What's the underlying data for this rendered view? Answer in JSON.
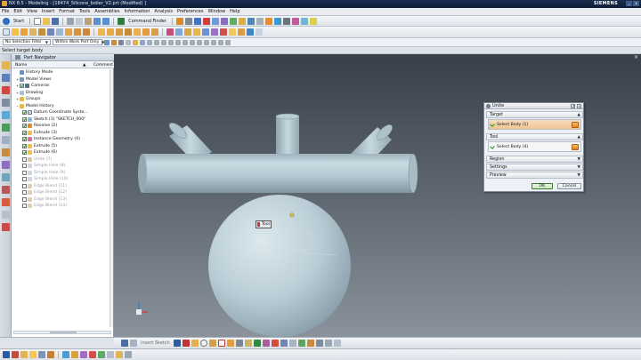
{
  "window": {
    "title": "NX 8.5 - Modeling - [18474_Silicone_boiler_V2.prt (Modified) ]",
    "brand": "SIEMENS"
  },
  "menu": [
    "File",
    "Edit",
    "View",
    "Insert",
    "Format",
    "Tools",
    "Assemblies",
    "Information",
    "Analysis",
    "Preferences",
    "Window",
    "Help"
  ],
  "toolbar": {
    "start_label": "Start",
    "command_finder_label": "Command Finder",
    "selection_filter": "No Selection Filter",
    "selection_scope": "Within Work Part Only"
  },
  "cue_line": "Select target body",
  "part_navigator": {
    "title": "Part Navigator",
    "col_name": "Name",
    "col_comment": "Comment",
    "items": [
      {
        "label": "History Mode",
        "indent": 0,
        "state": "normal"
      },
      {
        "label": "Model Views",
        "indent": 0,
        "state": "normal"
      },
      {
        "label": "Cameras",
        "indent": 0,
        "state": "normal"
      },
      {
        "label": "Drawing",
        "indent": 0,
        "state": "normal"
      },
      {
        "label": "Groups",
        "indent": 0,
        "state": "normal"
      },
      {
        "label": "Model History",
        "indent": 0,
        "state": "normal"
      },
      {
        "label": "Datum Coordinate Syste...",
        "indent": 1,
        "state": "normal"
      },
      {
        "label": "Sketch (1) \"SKETCH_000\"",
        "indent": 1,
        "state": "normal"
      },
      {
        "label": "Revolve (2)",
        "indent": 1,
        "state": "normal"
      },
      {
        "label": "Extrude (3)",
        "indent": 1,
        "state": "normal"
      },
      {
        "label": "Instance Geometry (4)",
        "indent": 1,
        "state": "normal"
      },
      {
        "label": "Extrude (5)",
        "indent": 1,
        "state": "normal"
      },
      {
        "label": "Extrude (6)",
        "indent": 1,
        "state": "normal"
      },
      {
        "label": "Unite (7)",
        "indent": 1,
        "state": "dim"
      },
      {
        "label": "Simple Hole (8)",
        "indent": 1,
        "state": "dim"
      },
      {
        "label": "Simple Hole (9)",
        "indent": 1,
        "state": "dim"
      },
      {
        "label": "Simple Hole (10)",
        "indent": 1,
        "state": "dim"
      },
      {
        "label": "Edge Blend (11)",
        "indent": 1,
        "state": "dim"
      },
      {
        "label": "Edge Blend (12)",
        "indent": 1,
        "state": "dim"
      },
      {
        "label": "Edge Blend (13)",
        "indent": 1,
        "state": "dim"
      },
      {
        "label": "Edge Blend (14)",
        "indent": 1,
        "state": "dim"
      }
    ]
  },
  "dialog": {
    "title": "Unite",
    "target_group": "Target",
    "target_select": "Select Body (1)",
    "tool_group": "Tool",
    "tool_select": "Select Body (4)",
    "region_group": "Region",
    "settings_group": "Settings",
    "preview_group": "Preview",
    "ok_label": "OK",
    "cancel_label": "Cancel"
  },
  "viewport": {
    "tool_tag": "Tool",
    "body_color": "#b8cdd6"
  },
  "bottom_toolbar": {
    "insert_sketch_label": "Insert Sketch"
  },
  "colors": {
    "titlebar": "#14264a",
    "accent_orange": "#e8a23a",
    "check_green": "#139a13"
  }
}
